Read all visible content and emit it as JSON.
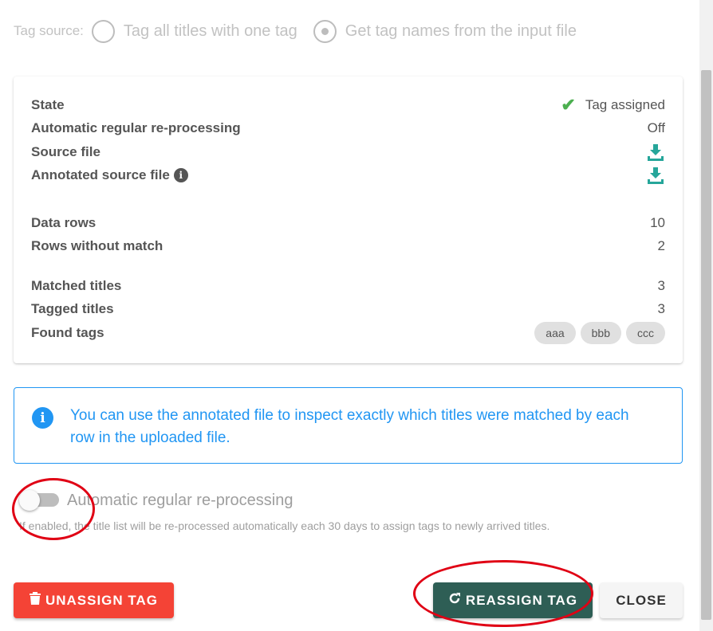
{
  "tag_source": {
    "label": "Tag source:",
    "options": [
      {
        "label": "Tag all titles with one tag",
        "checked": false
      },
      {
        "label": "Get tag names from the input file",
        "checked": true
      }
    ]
  },
  "summary": {
    "state": {
      "key": "State",
      "value": "Tag assigned",
      "icon": "check-icon"
    },
    "auto": {
      "key": "Automatic regular re-processing",
      "value": "Off"
    },
    "source": {
      "key": "Source file",
      "icon": "download-icon"
    },
    "annotated": {
      "key": "Annotated source file",
      "info": "i",
      "icon": "download-icon"
    },
    "data_rows": {
      "key": "Data rows",
      "value": "10"
    },
    "no_match": {
      "key": "Rows without match",
      "value": "2"
    },
    "matched": {
      "key": "Matched titles",
      "value": "3"
    },
    "tagged": {
      "key": "Tagged titles",
      "value": "3"
    },
    "found_tags": {
      "key": "Found tags",
      "tags": [
        "aaa",
        "bbb",
        "ccc"
      ]
    }
  },
  "alert": {
    "icon": "i",
    "text": "You can use the annotated file to inspect exactly which titles were matched by each row in the uploaded file."
  },
  "auto_toggle": {
    "label": "Automatic regular re-processing",
    "enabled": false,
    "hint": "If enabled, the title list will be re-processed automatically each 30 days to assign tags to newly arrived titles."
  },
  "buttons": {
    "unassign": "UNASSIGN TAG",
    "reassign": "REASSIGN TAG",
    "close": "CLOSE"
  },
  "colors": {
    "success": "#4caf50",
    "download": "#26a69a",
    "info": "#2196f3",
    "danger": "#f44336",
    "primary": "#2e5e55",
    "annotation": "#e00014"
  }
}
